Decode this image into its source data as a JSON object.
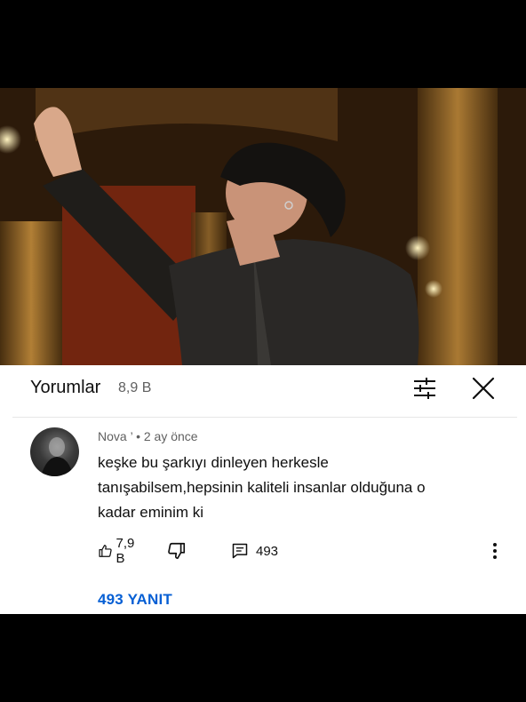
{
  "comments_header": {
    "title": "Yorumlar",
    "count": "8,9 B"
  },
  "comment": {
    "author": "Nova ’",
    "separator": "•",
    "time": "2 ay önce",
    "lines": [
      "keşke bu şarkıyı dinleyen herkesle",
      "tanışabilsem,hepsinin kaliteli insanlar olduğuna o",
      "kadar eminim ki"
    ],
    "likes": "7,9 B",
    "reply_count": "493",
    "replies_link": "493 YANIT"
  },
  "colors": {
    "link": "#065fd4",
    "text": "#0f0f0f",
    "muted": "#606060"
  },
  "icons": [
    "filter-icon",
    "close-icon",
    "like-icon",
    "dislike-icon",
    "reply-icon",
    "more-options-icon"
  ]
}
